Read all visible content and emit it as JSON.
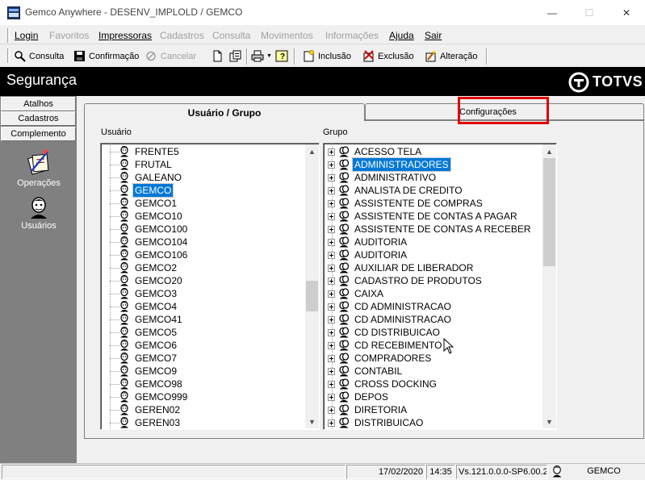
{
  "window": {
    "title": "Gemco Anywhere - DESENV_IMPLOLD / GEMCO",
    "minimize": "—",
    "maximize": "☐",
    "close": "✕"
  },
  "menu": [
    {
      "label": "Login",
      "enabled": true
    },
    {
      "label": "Favoritos",
      "enabled": false
    },
    {
      "label": "Impressoras",
      "enabled": true
    },
    {
      "label": "Cadastros",
      "enabled": false
    },
    {
      "label": "Consulta",
      "enabled": false
    },
    {
      "label": "Movimentos",
      "enabled": false
    },
    {
      "label": "Informações",
      "enabled": false
    },
    {
      "label": "Ajuda",
      "enabled": true
    },
    {
      "label": "Sair",
      "enabled": true
    }
  ],
  "toolbar": {
    "consulta": "Consulta",
    "confirmacao": "Confirmação",
    "cancelar": "Cancelar",
    "inclusao": "Inclusão",
    "exclusao": "Exclusão",
    "alteracao": "Alteração"
  },
  "header": {
    "title": "Segurança",
    "logo_text": "TOTVS"
  },
  "nav": {
    "atalhos": "Atalhos",
    "cadastros": "Cadastros",
    "complemento": "Complemento",
    "operacoes": "Operações",
    "usuarios": "Usuários"
  },
  "tabs": {
    "usuario_grupo": "Usuário  / Grupo",
    "configuracoes": "Configurações"
  },
  "usuario": {
    "label": "Usuário",
    "selected": "GEMCO",
    "items": [
      "FRENTE5",
      "FRUTAL",
      "GALEANO",
      "GEMCO",
      "GEMCO1",
      "GEMCO10",
      "GEMCO100",
      "GEMCO104",
      "GEMCO106",
      "GEMCO2",
      "GEMCO20",
      "GEMCO3",
      "GEMCO4",
      "GEMCO41",
      "GEMCO5",
      "GEMCO6",
      "GEMCO7",
      "GEMCO9",
      "GEMCO98",
      "GEMCO999",
      "GEREN02",
      "GEREN03"
    ]
  },
  "grupo": {
    "label": "Grupo",
    "selected": "ADMINISTRADORES",
    "items": [
      "ACESSO TELA",
      "ADMINISTRADORES",
      "ADMINISTRATIVO",
      "ANALISTA DE CREDITO",
      "ASSISTENTE DE COMPRAS",
      "ASSISTENTE DE CONTAS A PAGAR",
      "ASSISTENTE DE CONTAS A RECEBER",
      "AUDITORIA",
      "AUDITORIA",
      "AUXILIAR DE LIBERADOR",
      "CADASTRO DE PRODUTOS",
      "CAIXA",
      "CD ADMINISTRACAO",
      "CD ADMINISTRACAO",
      "CD DISTRIBUICAO",
      "CD RECEBIMENTO",
      "COMPRADORES",
      "CONTABIL",
      "CROSS DOCKING",
      "DEPOS",
      "DIRETORIA",
      "DISTRIBUICAO"
    ]
  },
  "status": {
    "date": "17/02/2020",
    "time": "14:35",
    "version": "Vs.121.0.0.0-SP6.00.2",
    "user": "GEMCO"
  },
  "colors": {
    "header_bg": "#000000",
    "selection": "#0078d7",
    "highlight_box": "#e00000",
    "left_panel": "#808080"
  }
}
